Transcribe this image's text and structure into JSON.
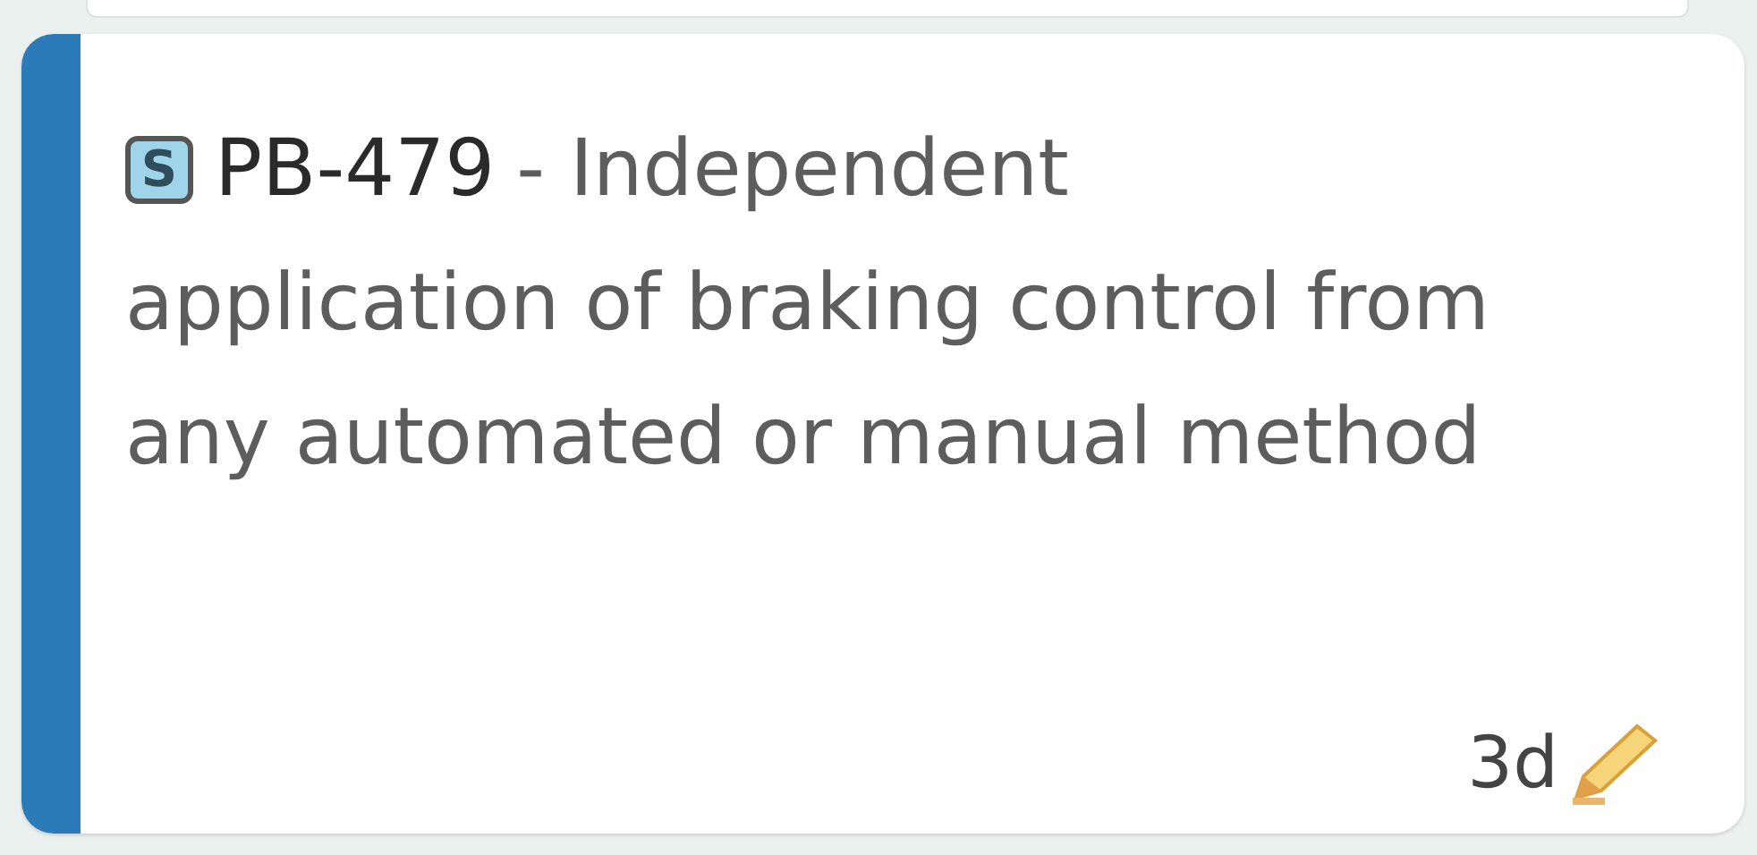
{
  "card": {
    "type_icon_letter": "S",
    "key": "PB-479",
    "summary_start": "- Independent",
    "summary_rest": "application of braking control from any automated or manual method",
    "age": "3d"
  }
}
